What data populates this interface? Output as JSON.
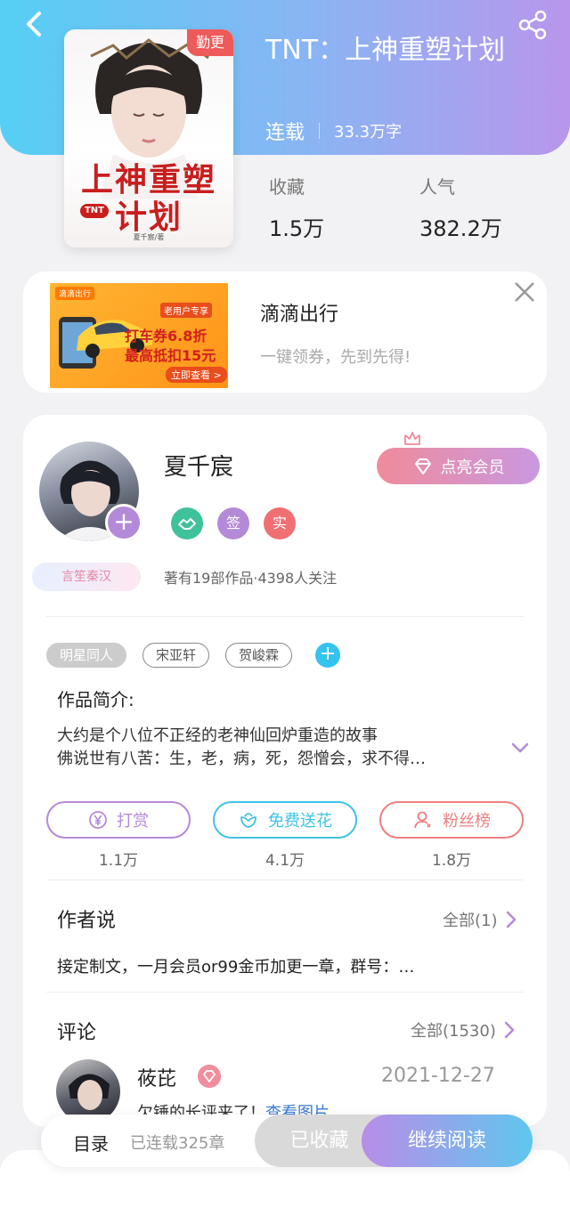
{
  "header": {
    "back_icon": "chevron-left-icon",
    "share_icon": "share-icon"
  },
  "book": {
    "cover_tag": "勤更",
    "cover_title": "上神重塑计划",
    "cover_logo": "TNT",
    "cover_author": "夏千宸/著",
    "title": "TNT：上神重塑计划",
    "status": "连载",
    "word_count": "33.3万字",
    "stats": [
      {
        "label": "收藏",
        "value": "1.5万"
      },
      {
        "label": "人气",
        "value": "382.2万"
      }
    ]
  },
  "ad": {
    "title": "滴滴出行",
    "subtitle": "一键领券，先到先得!",
    "image_brand": "滴滴出行",
    "image_badge": "老用户专享",
    "image_line1": "打车券6.8折",
    "image_line2": "最高抵扣15元",
    "image_cta": "立即查看 >",
    "close_icon": "close-icon"
  },
  "author": {
    "name": "夏千宸",
    "member_button": "点亮会员",
    "badges": [
      {
        "icon": "handshake-icon",
        "text": "",
        "color": "#3fc29a"
      },
      {
        "icon": "sign-badge-icon",
        "text": "签",
        "color": "#b48ad8"
      },
      {
        "icon": "real-badge-icon",
        "text": "实",
        "color": "#ef6f72"
      }
    ],
    "fan_tag": "言笙秦汉",
    "works_info": "著有19部作品·4398人关注"
  },
  "tags": [
    "明星同人",
    "宋亚轩",
    "贺峻霖"
  ],
  "intro": {
    "label": "作品简介:",
    "line1": "大约是个八位不正经的老神仙回炉重造的故事",
    "line2": "佛说世有八苦：生，老，病，死，怨憎会，求不得…"
  },
  "actions": [
    {
      "label": "打赏",
      "count": "1.1万",
      "icon": "yen-icon",
      "color": "#b48ad8"
    },
    {
      "label": "免费送花",
      "count": "4.1万",
      "icon": "flower-icon",
      "color": "#3fc3e7"
    },
    {
      "label": "粉丝榜",
      "count": "1.8万",
      "icon": "user-icon",
      "color": "#ef7f80"
    }
  ],
  "author_says": {
    "title": "作者说",
    "more": "全部(1)",
    "text": "接定制文，一月会员or99金币加更一章，群号：…"
  },
  "comments": {
    "title": "评论",
    "more": "全部(1530)",
    "first": {
      "user": "莜芘",
      "date": "2021-12-27",
      "text": "欠锤的长评来了！",
      "link": "查看图片"
    }
  },
  "bottom_bar": {
    "toc": "目录",
    "chapters": "已连载325章",
    "collected": "已收藏",
    "continue": "继续阅读"
  }
}
